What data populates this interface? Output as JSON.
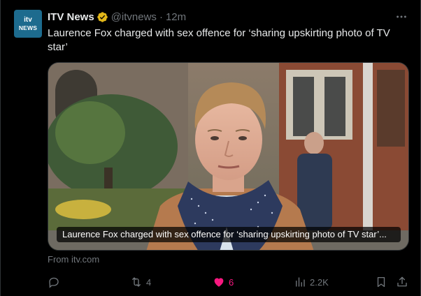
{
  "tweet": {
    "display_name": "ITV News",
    "handle": "@itvnews",
    "separator": "·",
    "time": "12m",
    "text": "Laurence Fox charged with sex offence for ‘sharing upskirting photo of TV star’",
    "avatar": {
      "line1": "itv",
      "line2": "NEWS",
      "bg": "#1d6b8e"
    },
    "verified_badge": {
      "color": "#e2b719",
      "icon": "verified-gold-badge"
    }
  },
  "media": {
    "caption": "Laurence Fox charged with sex offence for ‘sharing upskirting photo of TV star’...",
    "icon": "link-card-photo"
  },
  "source": "From itv.com",
  "actions": {
    "reply": {
      "icon": "reply-icon",
      "count": ""
    },
    "retweet": {
      "icon": "retweet-icon",
      "count": "4"
    },
    "like": {
      "icon": "heart-icon",
      "count": "6",
      "active": true,
      "color": "#f91880"
    },
    "views": {
      "icon": "views-icon",
      "count": "2.2K"
    },
    "bookmark": {
      "icon": "bookmark-icon"
    },
    "share": {
      "icon": "share-icon"
    }
  },
  "colors": {
    "background": "#000000",
    "text": "#e7e9ea",
    "muted": "#71767b",
    "border": "#2f3336"
  }
}
